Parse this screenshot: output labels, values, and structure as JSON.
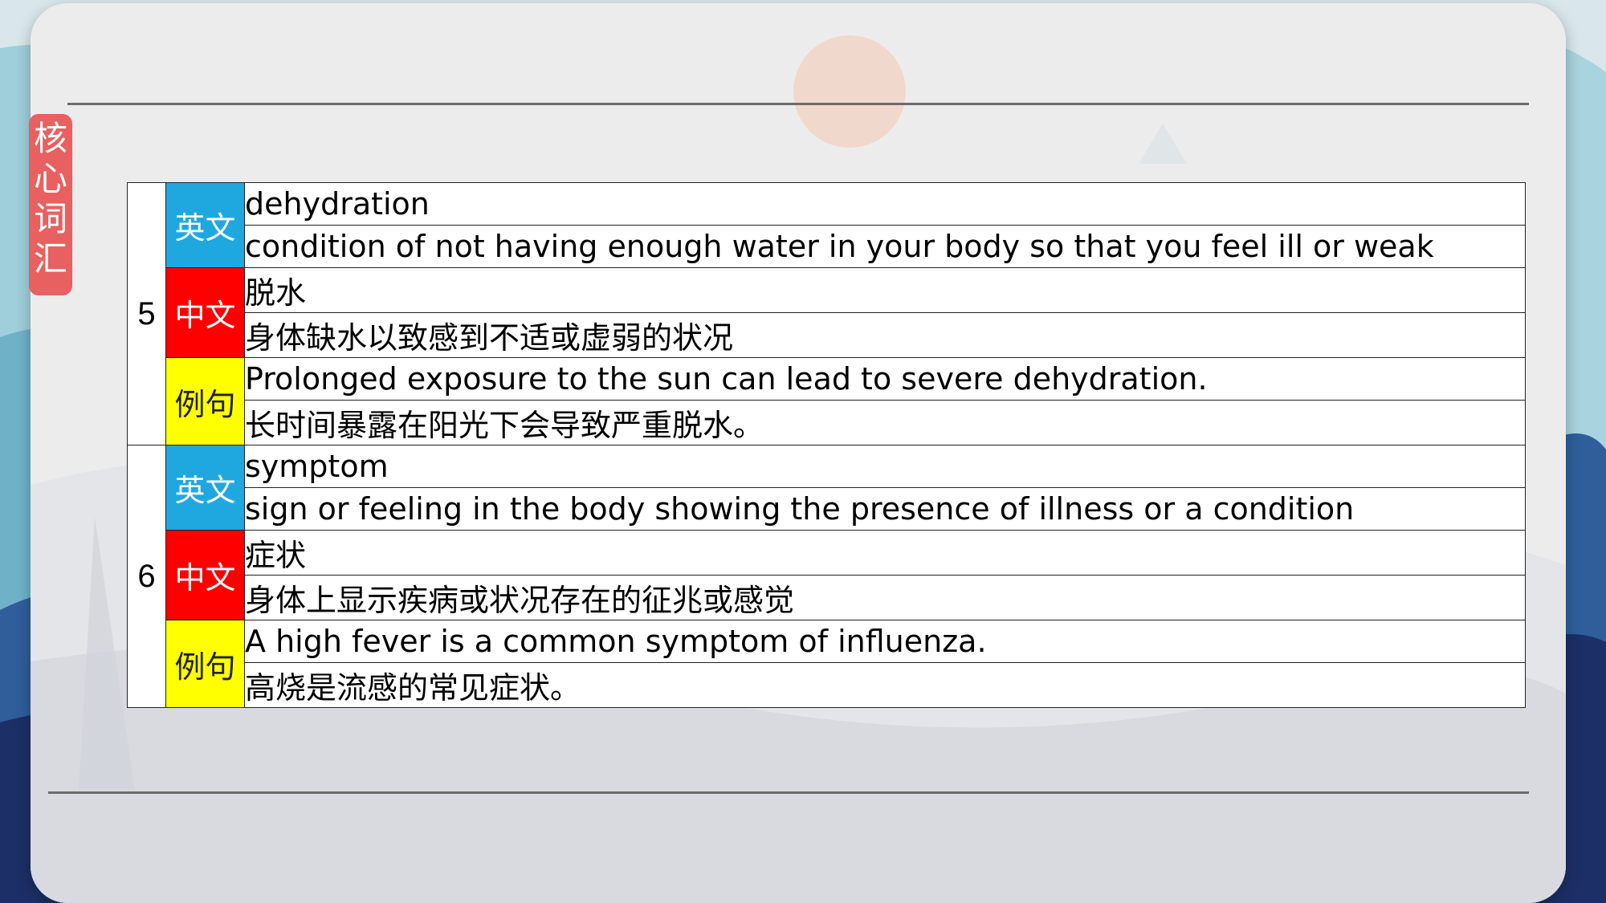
{
  "side_tag": [
    "核",
    "心",
    "词",
    "汇"
  ],
  "entries": [
    {
      "number": "5",
      "rows": [
        {
          "label": "英文",
          "lines": [
            "dehydration",
            "condition of not having enough water in your body so that you feel ill or weak"
          ]
        },
        {
          "label": "中文",
          "lines": [
            "脱水",
            "身体缺水以致感到不适或虚弱的状况"
          ]
        },
        {
          "label": "例句",
          "lines": [
            "Prolonged exposure to the sun can lead to severe dehydration.",
            "长时间暴露在阳光下会导致严重脱水。"
          ]
        }
      ]
    },
    {
      "number": "6",
      "rows": [
        {
          "label": "英文",
          "lines": [
            "symptom",
            "sign or feeling in the body showing the presence of illness or a condition"
          ]
        },
        {
          "label": "中文",
          "lines": [
            "症状",
            "身体上显示疾病或状况存在的征兆或感觉"
          ]
        },
        {
          "label": "例句",
          "lines": [
            "A high fever is a common symptom of influenza.",
            "高烧是流感的常见症状。"
          ]
        }
      ]
    }
  ],
  "colors": {
    "english_label": "#1fa8e0",
    "chinese_label": "#ff0000",
    "example_label": "#ffff00",
    "side_tag": "#e8605f"
  }
}
